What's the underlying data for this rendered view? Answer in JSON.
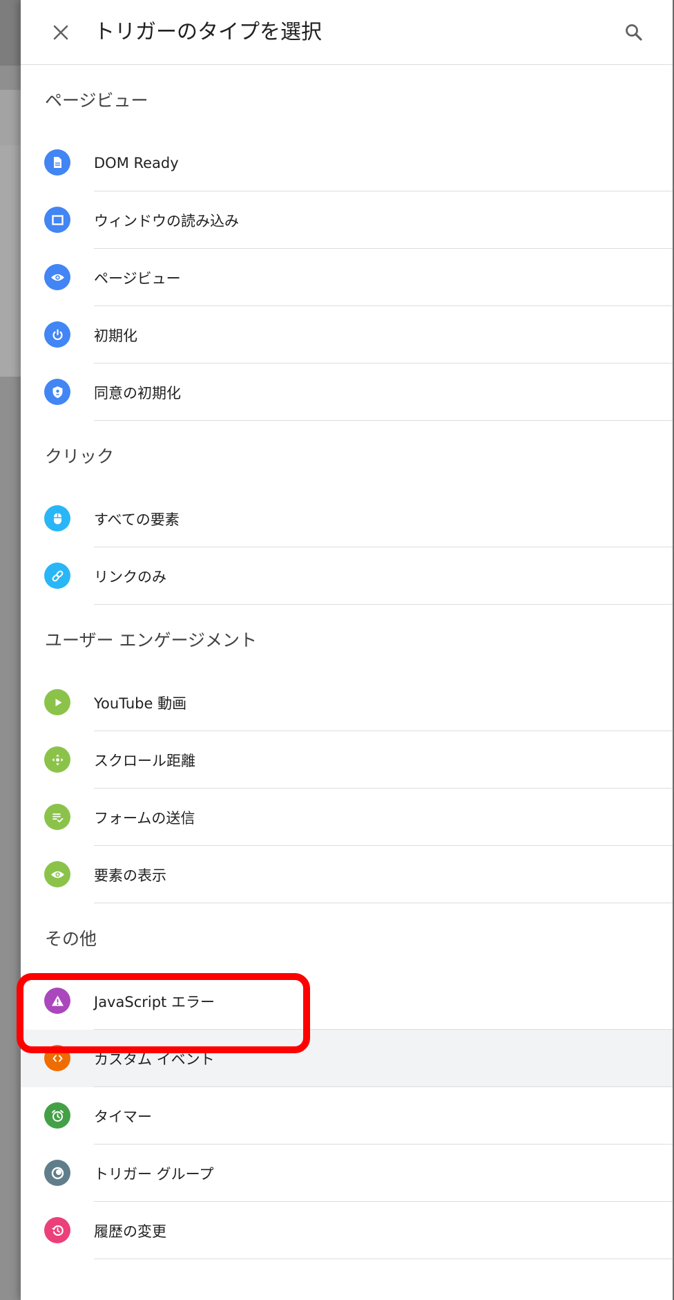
{
  "header": {
    "title": "トリガーのタイプを選択"
  },
  "sections": [
    {
      "title": "ページビュー",
      "items": [
        {
          "label": "DOM Ready",
          "icon": "document-icon",
          "color": "#4285f4"
        },
        {
          "label": "ウィンドウの読み込み",
          "icon": "window-icon",
          "color": "#4285f4"
        },
        {
          "label": "ページビュー",
          "icon": "eye-icon",
          "color": "#4285f4"
        },
        {
          "label": "初期化",
          "icon": "power-icon",
          "color": "#4285f4"
        },
        {
          "label": "同意の初期化",
          "icon": "shield-icon",
          "color": "#4285f4"
        }
      ]
    },
    {
      "title": "クリック",
      "items": [
        {
          "label": "すべての要素",
          "icon": "mouse-icon",
          "color": "#29b6f6"
        },
        {
          "label": "リンクのみ",
          "icon": "link-icon",
          "color": "#29b6f6"
        }
      ]
    },
    {
      "title": "ユーザー エンゲージメント",
      "items": [
        {
          "label": "YouTube 動画",
          "icon": "play-icon",
          "color": "#8bc34a"
        },
        {
          "label": "スクロール距離",
          "icon": "move-icon",
          "color": "#8bc34a"
        },
        {
          "label": "フォームの送信",
          "icon": "form-check-icon",
          "color": "#8bc34a"
        },
        {
          "label": "要素の表示",
          "icon": "eye-icon",
          "color": "#8bc34a"
        }
      ]
    },
    {
      "title": "その他",
      "items": [
        {
          "label": "JavaScript エラー",
          "icon": "warning-icon",
          "color": "#ab47bc"
        },
        {
          "label": "カスタム イベント",
          "icon": "code-icon",
          "color": "#ef6c00",
          "highlighted": true
        },
        {
          "label": "タイマー",
          "icon": "alarm-icon",
          "color": "#43a047"
        },
        {
          "label": "トリガー グループ",
          "icon": "group-icon",
          "color": "#607d8b"
        },
        {
          "label": "履歴の変更",
          "icon": "history-icon",
          "color": "#ec407a"
        }
      ]
    }
  ]
}
